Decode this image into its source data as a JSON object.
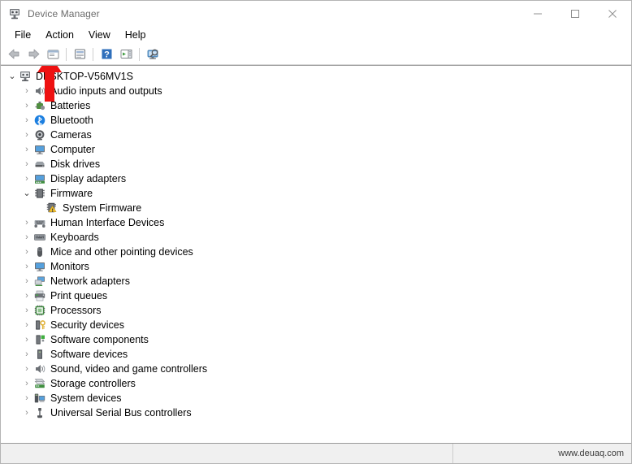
{
  "window": {
    "title": "Device Manager",
    "title_icon": "device-manager-icon",
    "controls": [
      {
        "name": "minimize-button",
        "glyph": "minimize"
      },
      {
        "name": "maximize-button",
        "glyph": "maximize"
      },
      {
        "name": "close-button",
        "glyph": "close"
      }
    ]
  },
  "menubar": {
    "items": [
      {
        "label": "File",
        "name": "menu-file"
      },
      {
        "label": "Action",
        "name": "menu-action"
      },
      {
        "label": "View",
        "name": "menu-view"
      },
      {
        "label": "Help",
        "name": "menu-help"
      }
    ]
  },
  "toolbar": {
    "buttons": [
      {
        "name": "back-button",
        "icon": "back-arrow-icon"
      },
      {
        "name": "forward-button",
        "icon": "forward-arrow-icon"
      },
      {
        "name": "up-one-level-button",
        "icon": "up-folder-icon"
      },
      {
        "name": "properties-button",
        "icon": "properties-icon"
      },
      {
        "name": "help-button",
        "icon": "help-question-icon"
      },
      {
        "name": "update-driver-button",
        "icon": "update-driver-icon"
      },
      {
        "name": "scan-hardware-changes-button",
        "icon": "scan-monitor-icon"
      }
    ]
  },
  "tree": {
    "root": {
      "label": "DESKTOP-V56MV1S",
      "icon": "computer-root-icon",
      "expanded": true,
      "indent": 0
    },
    "items": [
      {
        "label": "Audio inputs and outputs",
        "icon": "speaker-icon",
        "expandable": true,
        "expanded": false,
        "indent": 1
      },
      {
        "label": "Batteries",
        "icon": "battery-icon",
        "expandable": true,
        "expanded": false,
        "indent": 1
      },
      {
        "label": "Bluetooth",
        "icon": "bluetooth-icon",
        "expandable": true,
        "expanded": false,
        "indent": 1
      },
      {
        "label": "Cameras",
        "icon": "camera-icon",
        "expandable": true,
        "expanded": false,
        "indent": 1
      },
      {
        "label": "Computer",
        "icon": "monitor-icon",
        "expandable": true,
        "expanded": false,
        "indent": 1
      },
      {
        "label": "Disk drives",
        "icon": "disk-drive-icon",
        "expandable": true,
        "expanded": false,
        "indent": 1
      },
      {
        "label": "Display adapters",
        "icon": "display-adapter-icon",
        "expandable": true,
        "expanded": false,
        "indent": 1
      },
      {
        "label": "Firmware",
        "icon": "firmware-chip-icon",
        "expandable": true,
        "expanded": true,
        "indent": 1
      },
      {
        "label": "System Firmware",
        "icon": "system-firmware-warning-icon",
        "expandable": false,
        "expanded": false,
        "indent": 2,
        "warning": true
      },
      {
        "label": "Human Interface Devices",
        "icon": "hid-icon",
        "expandable": true,
        "expanded": false,
        "indent": 1
      },
      {
        "label": "Keyboards",
        "icon": "keyboard-icon",
        "expandable": true,
        "expanded": false,
        "indent": 1
      },
      {
        "label": "Mice and other pointing devices",
        "icon": "mouse-icon",
        "expandable": true,
        "expanded": false,
        "indent": 1
      },
      {
        "label": "Monitors",
        "icon": "monitor-icon",
        "expandable": true,
        "expanded": false,
        "indent": 1
      },
      {
        "label": "Network adapters",
        "icon": "network-adapter-icon",
        "expandable": true,
        "expanded": false,
        "indent": 1
      },
      {
        "label": "Print queues",
        "icon": "printer-icon",
        "expandable": true,
        "expanded": false,
        "indent": 1
      },
      {
        "label": "Processors",
        "icon": "processor-icon",
        "expandable": true,
        "expanded": false,
        "indent": 1
      },
      {
        "label": "Security devices",
        "icon": "security-key-icon",
        "expandable": true,
        "expanded": false,
        "indent": 1
      },
      {
        "label": "Software components",
        "icon": "software-component-icon",
        "expandable": true,
        "expanded": false,
        "indent": 1
      },
      {
        "label": "Software devices",
        "icon": "software-device-icon",
        "expandable": true,
        "expanded": false,
        "indent": 1
      },
      {
        "label": "Sound, video and game controllers",
        "icon": "speaker-icon",
        "expandable": true,
        "expanded": false,
        "indent": 1
      },
      {
        "label": "Storage controllers",
        "icon": "storage-controller-icon",
        "expandable": true,
        "expanded": false,
        "indent": 1
      },
      {
        "label": "System devices",
        "icon": "system-device-icon",
        "expandable": true,
        "expanded": false,
        "indent": 1
      },
      {
        "label": "Universal Serial Bus controllers",
        "icon": "usb-icon",
        "expandable": true,
        "expanded": false,
        "indent": 1
      }
    ]
  },
  "statusbar": {
    "left_text": "",
    "watermark": "www.deuaq.com"
  },
  "annotation": {
    "arrow": {
      "name": "red-arrow-annotation",
      "color": "#EE1111",
      "points_to": "Action"
    }
  },
  "colors": {
    "window_border": "#b4b4b4",
    "title_text": "#6b6b6b",
    "statusbar_bg": "#f0f0f0",
    "arrow_red": "#EE1111"
  }
}
